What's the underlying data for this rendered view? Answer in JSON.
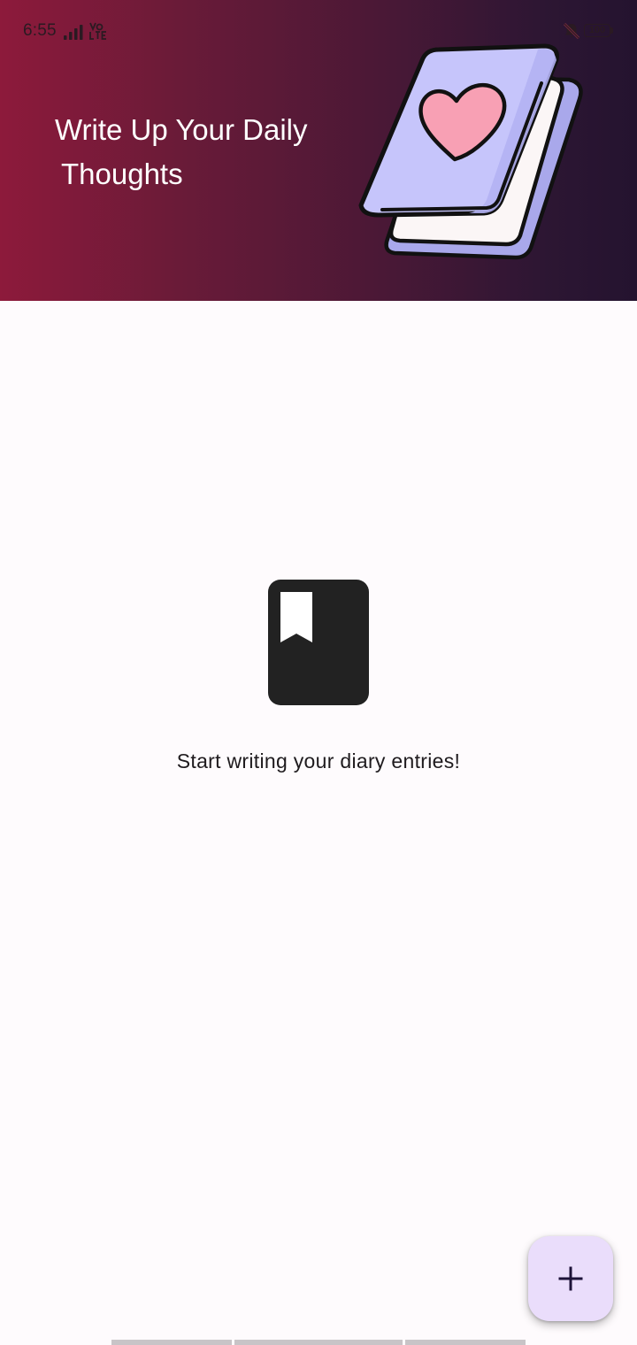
{
  "status_bar": {
    "time": "6:55",
    "battery": "100",
    "icons": [
      "signal-icon",
      "volte-icon",
      "bell-off-icon",
      "battery-icon"
    ]
  },
  "header": {
    "title_line1": "Write Up Your Daily",
    "title_line2": "Thoughts",
    "illustration": "diary-heart-book-illustration"
  },
  "empty_state": {
    "icon": "bookmark-book-icon",
    "message": "Start writing your diary entries!"
  },
  "fab": {
    "icon": "plus-icon",
    "background": "#eaddfb"
  },
  "colors": {
    "header_gradient_start": "#8d1a3b",
    "header_gradient_end": "#24132f",
    "page_background": "#fefbfd"
  }
}
